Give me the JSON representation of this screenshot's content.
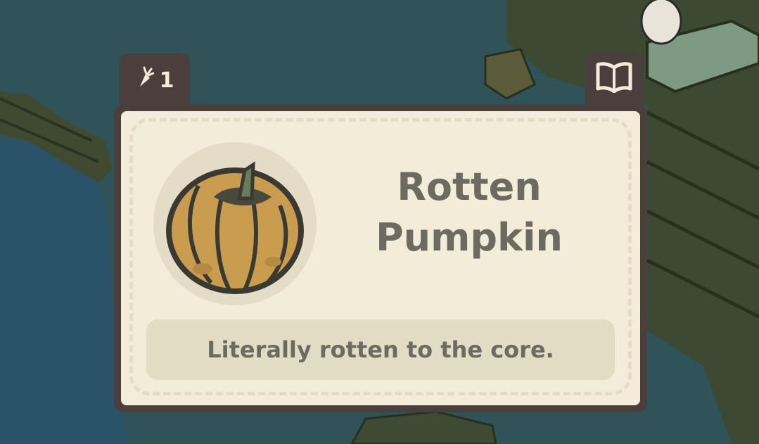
{
  "scene": {
    "water_color": "#2f5358",
    "deck_color": "#3a4a33"
  },
  "item": {
    "count": "1",
    "count_icon": "carrot-icon",
    "name_line1": "Rotten",
    "name_line2": "Pumpkin",
    "description": "Literally rotten to the core.",
    "image_icon": "rotten-pumpkin-icon"
  },
  "toolbar": {
    "journal_icon": "open-book-icon"
  },
  "colors": {
    "frame": "#4a3f3c",
    "card_bg": "#f2ecd9",
    "text": "#6d6a5f",
    "desc_bg": "#e2dcc4"
  }
}
